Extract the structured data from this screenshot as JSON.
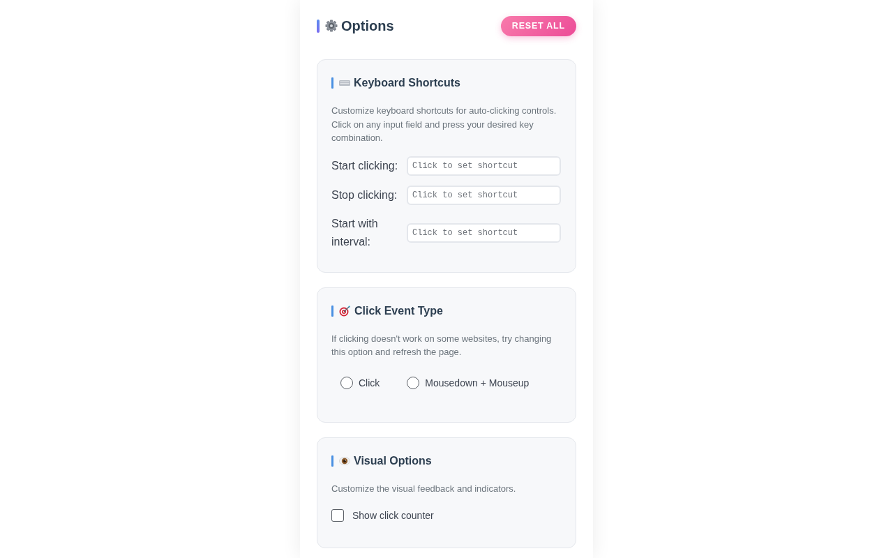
{
  "header": {
    "title": "Options",
    "reset_button": "RESET ALL"
  },
  "sections": [
    {
      "kind": "shortcuts",
      "title": "Keyboard Shortcuts",
      "description": "Customize keyboard shortcuts for auto-clicking controls. Click on any input field and press your desired key combination.",
      "shortcuts": [
        {
          "label": "Start clicking:",
          "placeholder": "Click to set shortcut"
        },
        {
          "label": "Stop clicking:",
          "placeholder": "Click to set shortcut"
        },
        {
          "label": "Start with interval:",
          "placeholder": "Click to set shortcut"
        }
      ]
    },
    {
      "kind": "radio",
      "title": "Click Event Type",
      "description": "If clicking doesn't work on some websites, try changing this option and refresh the page.",
      "options": [
        {
          "label": "Click",
          "selected": false
        },
        {
          "label": "Mousedown + Mouseup",
          "selected": false
        }
      ]
    },
    {
      "kind": "checkbox",
      "title": "Visual Options",
      "description": "Customize the visual feedback and indicators.",
      "options": [
        {
          "label": "Show click counter",
          "checked": false
        }
      ]
    }
  ]
}
